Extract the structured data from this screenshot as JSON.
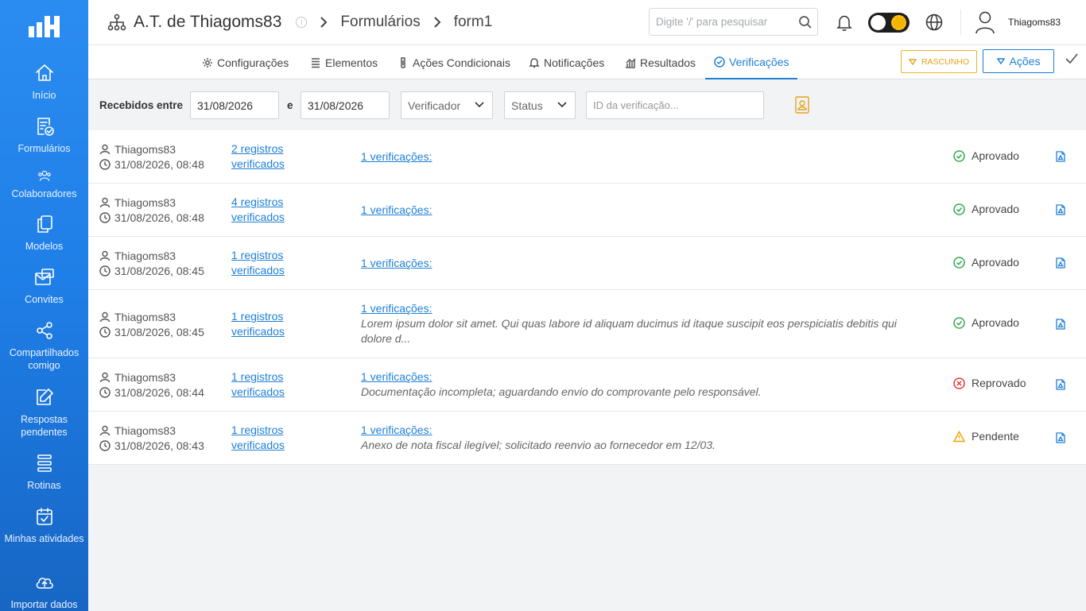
{
  "app": {
    "logo": "logo-icon"
  },
  "sidebar": {
    "items": [
      {
        "label": "Início",
        "icon": "home-icon"
      },
      {
        "label": "Formulários",
        "icon": "form-check-icon"
      },
      {
        "label": "Colaboradores",
        "icon": "users-icon"
      },
      {
        "label": "Modelos",
        "icon": "copy-icon"
      },
      {
        "label": "Convites",
        "icon": "mail-icon"
      },
      {
        "label": "Compartilhados comigo",
        "icon": "share-icon"
      },
      {
        "label": "Respostas pendentes",
        "icon": "edit-icon"
      },
      {
        "label": "Rotinas",
        "icon": "list-icon"
      },
      {
        "label": "Minhas atividades",
        "icon": "calendar-check-icon"
      },
      {
        "label": "Importar dados",
        "icon": "cloud-upload-icon"
      }
    ]
  },
  "header": {
    "org": "A.T. de Thiagoms83",
    "info": "i",
    "crumb1": "Formulários",
    "crumb2": "form1",
    "search_placeholder": "Digite '/' para pesquisar",
    "username": "Thiagoms83"
  },
  "tabs": [
    {
      "label": "Configurações",
      "icon": "gear-icon"
    },
    {
      "label": "Elementos",
      "icon": "list-icon"
    },
    {
      "label": "Ações Condicionais",
      "icon": "clip-icon"
    },
    {
      "label": "Notificações",
      "icon": "bell-icon"
    },
    {
      "label": "Resultados",
      "icon": "chart-icon"
    },
    {
      "label": "Verificações",
      "icon": "check-circle-icon",
      "active": true
    }
  ],
  "actions": {
    "draft": "RASCUNHO",
    "acoes": "Ações"
  },
  "filters": {
    "label": "Recebidos entre",
    "date_from": "31/08/2026",
    "and": "e",
    "date_to": "31/08/2026",
    "verifier": "Verificador",
    "status": "Status",
    "id_placeholder": "ID da verificação..."
  },
  "rows": [
    {
      "user": "Thiagoms83",
      "date": "31/08/2026, 08:48",
      "reg1": "2 registros",
      "reg2": "verificados",
      "ver": "1 verificações:",
      "note": "",
      "status": "Aprovado",
      "status_color": "#2faa4a"
    },
    {
      "user": "Thiagoms83",
      "date": "31/08/2026, 08:48",
      "reg1": "4 registros",
      "reg2": "verificados",
      "ver": "1 verificações:",
      "note": "",
      "status": "Aprovado",
      "status_color": "#2faa4a"
    },
    {
      "user": "Thiagoms83",
      "date": "31/08/2026, 08:45",
      "reg1": "1 registros",
      "reg2": "verificados",
      "ver": "1 verificações:",
      "note": "",
      "status": "Aprovado",
      "status_color": "#2faa4a"
    },
    {
      "user": "Thiagoms83",
      "date": "31/08/2026, 08:45",
      "reg1": "1 registros",
      "reg2": "verificados",
      "ver": "1 verificações:",
      "note": "Lorem ipsum dolor sit amet. Qui quas labore id aliquam ducimus id itaque suscipit eos perspiciatis debitis qui dolore d...",
      "status": "Aprovado",
      "status_color": "#2faa4a"
    },
    {
      "user": "Thiagoms83",
      "date": "31/08/2026, 08:44",
      "reg1": "1 registros",
      "reg2": "verificados",
      "ver": "1 verificações:",
      "note": "Documentação incompleta; aguardando envio do comprovante pelo responsável.",
      "status": "Reprovado",
      "status_color": "#e53935"
    },
    {
      "user": "Thiagoms83",
      "date": "31/08/2026, 08:43",
      "reg1": "1 registros",
      "reg2": "verificados",
      "ver": "1 verificações:",
      "note": "Anexo de nota fiscal ilegível; solicitado reenvio ao fornecedor em 12/03.",
      "status": "Pendente",
      "status_color": "#f0a500"
    }
  ]
}
